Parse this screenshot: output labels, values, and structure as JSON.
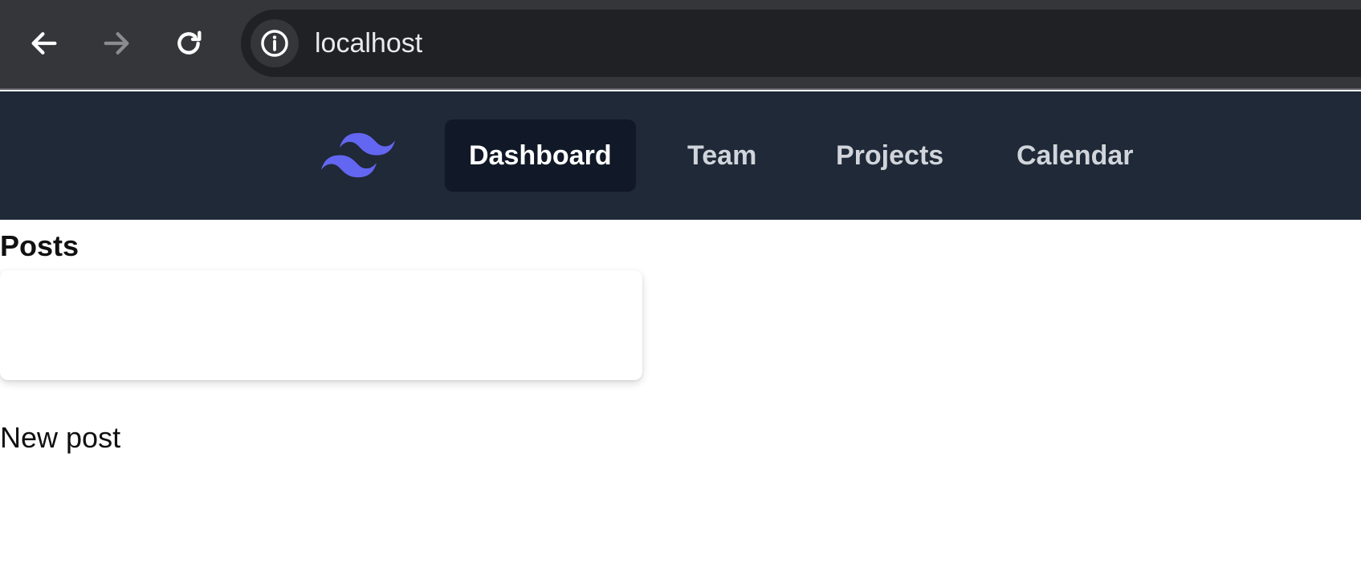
{
  "browser": {
    "url": "localhost",
    "icons": {
      "back": "arrow-left-icon",
      "forward": "arrow-right-icon",
      "reload": "reload-icon",
      "site_info": "info-icon"
    }
  },
  "nav": {
    "logo_icon": "tailwind-logo-icon",
    "accent_color": "#6366f1",
    "items": [
      {
        "label": "Dashboard",
        "active": true
      },
      {
        "label": "Team",
        "active": false
      },
      {
        "label": "Projects",
        "active": false
      },
      {
        "label": "Calendar",
        "active": false
      }
    ]
  },
  "main": {
    "posts_heading": "Posts",
    "new_post_label": "New post"
  }
}
